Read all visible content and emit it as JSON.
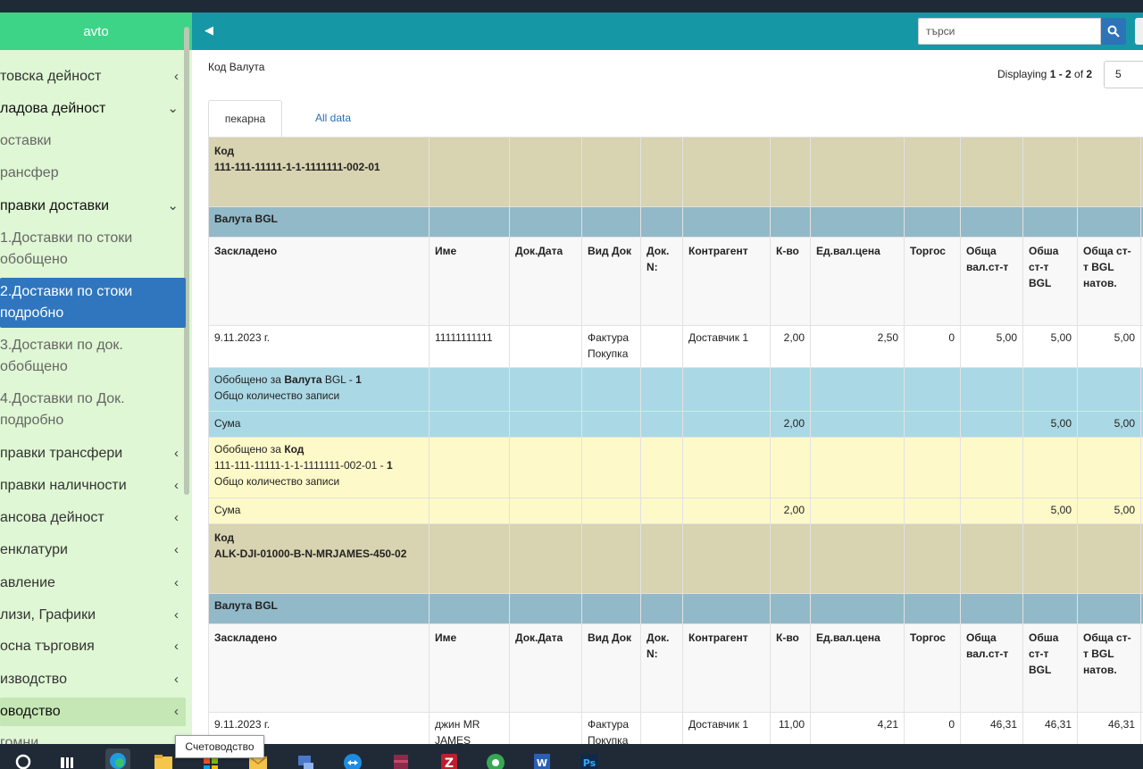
{
  "sidebar": {
    "app_title": "avto",
    "items": [
      {
        "label": "товска дейност",
        "chevron": "‹"
      },
      {
        "label": "ладова дейност",
        "chevron": "⌄"
      },
      {
        "label": "оставки",
        "chevron": ""
      },
      {
        "label": "рансфер",
        "chevron": ""
      },
      {
        "label": "правки доставки",
        "chevron": "⌄"
      },
      {
        "label": "1.Доставки по стоки обобщено",
        "chevron": ""
      },
      {
        "label": "2.Доставки по стоки подробно",
        "chevron": ""
      },
      {
        "label": "3.Доставки по док. обобщено",
        "chevron": ""
      },
      {
        "label": "4.Доставки по Док. подробно",
        "chevron": ""
      },
      {
        "label": "правки трансфери",
        "chevron": "‹"
      },
      {
        "label": "правки наличности",
        "chevron": "‹"
      },
      {
        "label": "ансова дейност",
        "chevron": "‹"
      },
      {
        "label": "енклатури",
        "chevron": "‹"
      },
      {
        "label": "авление",
        "chevron": "‹"
      },
      {
        "label": "лизи, Графики",
        "chevron": "‹"
      },
      {
        "label": "осна търговия",
        "chevron": "‹"
      },
      {
        "label": "изводство",
        "chevron": "‹"
      },
      {
        "label": "оводство",
        "chevron": "‹"
      },
      {
        "label": "гомни",
        "chevron": ""
      }
    ]
  },
  "header": {
    "search_placeholder": "търси"
  },
  "main": {
    "title": "Код Валута",
    "displaying_prefix": "Displaying ",
    "displaying_range": "1 - 2",
    "displaying_of": " of ",
    "displaying_total": "2",
    "page_size": "5",
    "tabs": [
      {
        "label": "пекарна"
      },
      {
        "label": "All data"
      }
    ]
  },
  "table": {
    "columns": [
      "Заскладено",
      "Име",
      "Док.Дата",
      "Вид Док",
      "Док. N:",
      "Контрагент",
      "К-во",
      "Ед.вал.цена",
      "Торгос",
      "Обща вал.ст-т",
      "Обша ст-т BGL",
      "Обща ст-т BGL натов."
    ],
    "groups": [
      {
        "code_label": "Код",
        "code": "111-111-11111-1-1-1111111-002-01",
        "currency_label": "Валута",
        "currency": "BGL",
        "row": [
          "9.11.2023 г.",
          "11111111111",
          "",
          "Фактура Покупка",
          "",
          "Доставчик 1",
          "2,00",
          "2,50",
          "0",
          "5,00",
          "5,00",
          "5,00"
        ],
        "sum_curr_prefix": "Обобщено за ",
        "sum_curr_key": "Валута",
        "sum_curr_value": " BGL  - ",
        "sum_curr_count": "1",
        "records_label": "Общо количество записи",
        "sum_label": "Сума",
        "sum_qty": "2,00",
        "sum_bgl": "5,00",
        "sum_bgl_vat": "5,00",
        "sum_code_prefix": "Обобщено за ",
        "sum_code_key": "Код",
        "sum_code_value": "111-111-11111-1-1-1111111-002-01  - ",
        "sum_code_count": "1"
      },
      {
        "code_label": "Код",
        "code": "ALK-DJI-01000-B-N-MRJAMES-450-02",
        "currency_label": "Валута",
        "currency": "BGL",
        "row": [
          "9.11.2023 г.",
          "джин MR JAMES",
          "",
          "Фактура Покупка",
          "",
          "Доставчик 1",
          "11,00",
          "4,21",
          "0",
          "46,31",
          "46,31",
          "46,31"
        ]
      }
    ]
  },
  "taskbar": {
    "tooltip": "Счетоводство",
    "icons": [
      "search-icon",
      "task-view-icon",
      "edge-icon",
      "folder-icon",
      "store-icon",
      "mail-icon",
      "network-icon",
      "teamviewer-icon",
      "winrar-icon",
      "filezilla-icon",
      "chrome-icon",
      "word-icon",
      "photoshop-icon"
    ]
  },
  "colors": {
    "sidebar_bg": "#dff7d4",
    "sidebar_head": "#3dd487",
    "header_bg": "#1697a6",
    "active_item": "#2f76bf",
    "group_row": "#d8d3b0",
    "currency_row": "#92b9c8",
    "sum_currency_row": "#abd8e5",
    "sum_code_row": "#fef9c9"
  }
}
